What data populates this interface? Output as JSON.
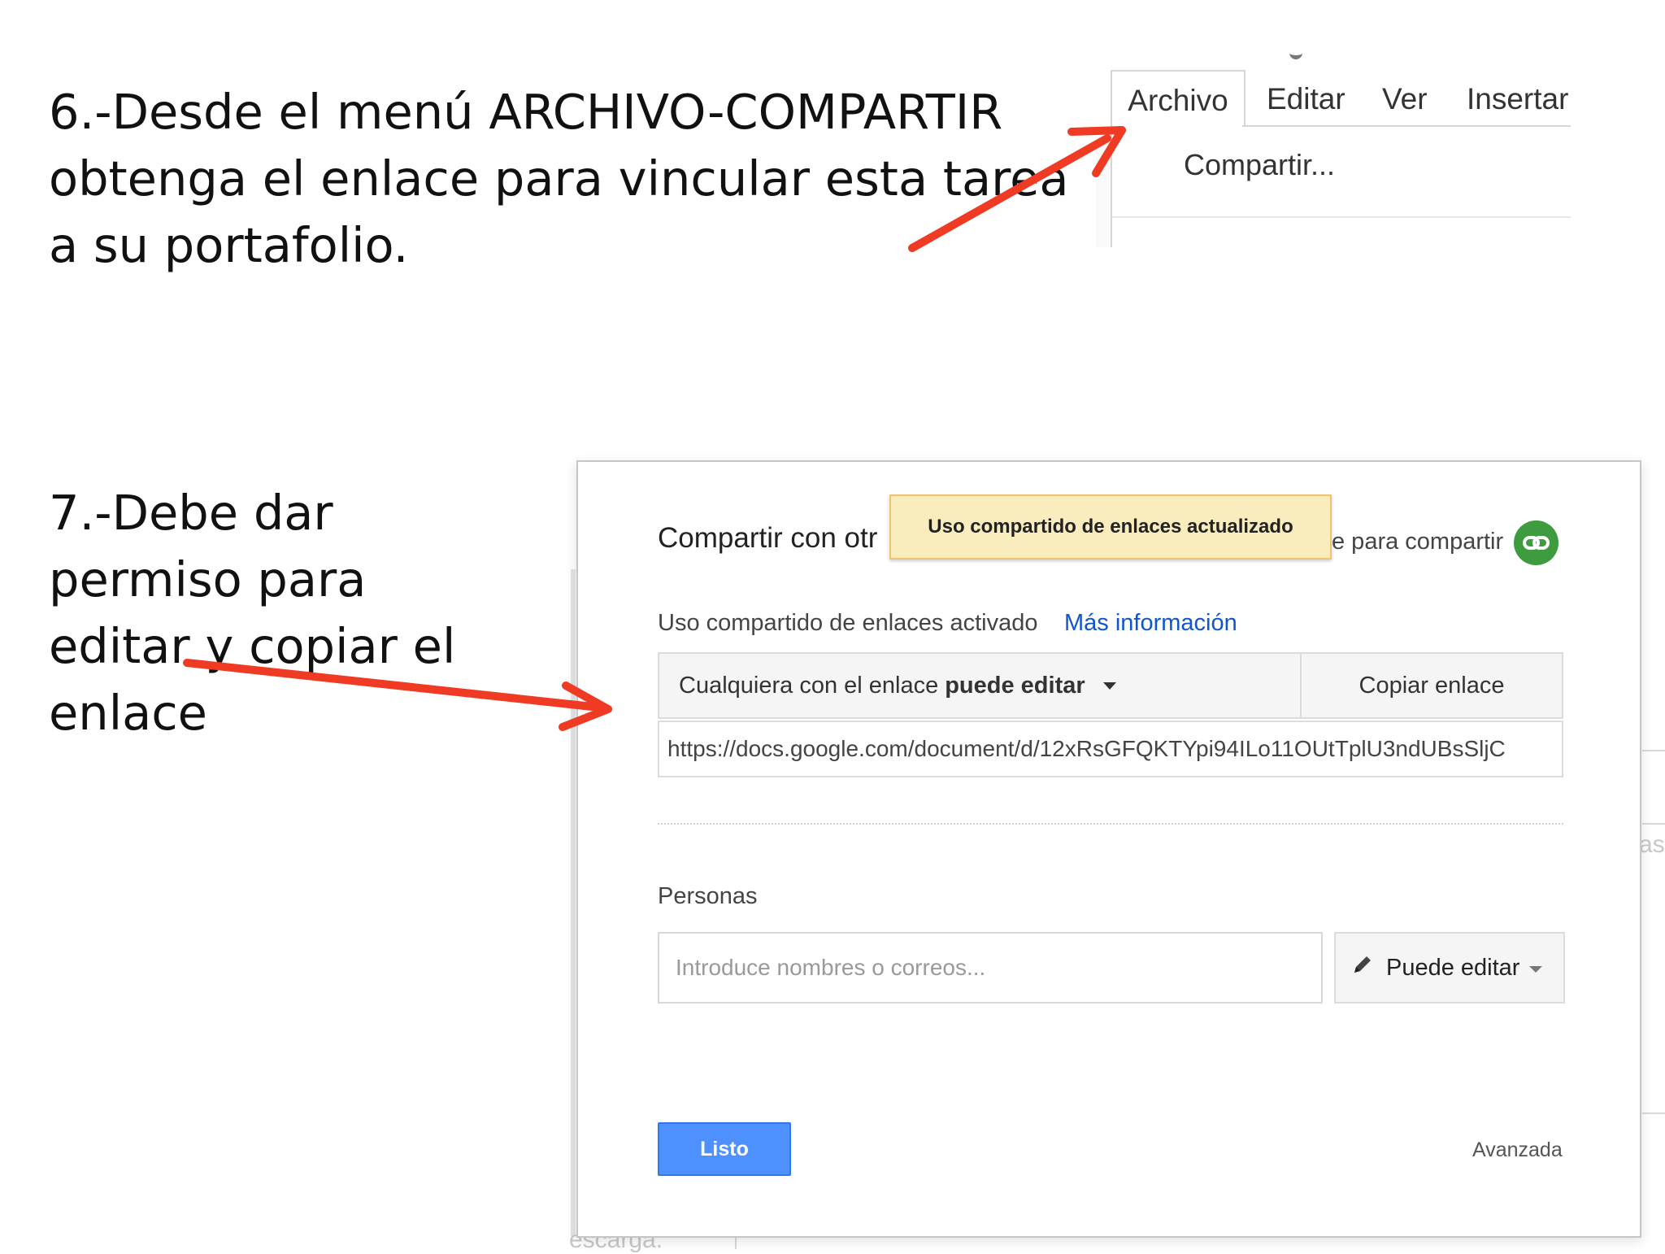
{
  "step6": {
    "lines": [
      "6.-Desde el menú ARCHIVO-COMPARTIR",
      "obtenga el enlace para vincular esta tarea",
      "a su portafolio."
    ]
  },
  "step7": {
    "lines": [
      "7.-Debe dar",
      "permiso para",
      "editar y copiar el",
      "enlace"
    ]
  },
  "menu": {
    "tabs": [
      "Archivo",
      "Editar",
      "Ver",
      "Insertar"
    ],
    "item": "Compartir..."
  },
  "share_dialog": {
    "title": "Compartir con otr",
    "link_hint": "e para compartir",
    "toast": "Uso compartido de enlaces actualizado",
    "link_sharing_status": "Uso compartido de enlaces activado",
    "more_info": "Más información",
    "permission_prefix": "Cualquiera con el enlace",
    "permission_level": "puede editar",
    "copy_link": "Copiar enlace",
    "url": "https://docs.google.com/document/d/12xRsGFQKTYpi94ILo11OUtTplU3ndUBsSljC",
    "people_label": "Personas",
    "people_placeholder": "Introduce nombres o correos...",
    "edit_permission": "Puede editar",
    "done": "Listo",
    "advanced": "Avanzada"
  },
  "background": {
    "right_fragment": "as",
    "bottom_fragment": "escarga."
  },
  "colors": {
    "arrow": "#ef3b24",
    "done_button": "#4d90fe",
    "link_icon": "#3f9b3f",
    "toast": "#f9edbe",
    "link": "#1155cc"
  },
  "icons": [
    "link-icon",
    "pencil-icon",
    "caret-down-icon"
  ]
}
